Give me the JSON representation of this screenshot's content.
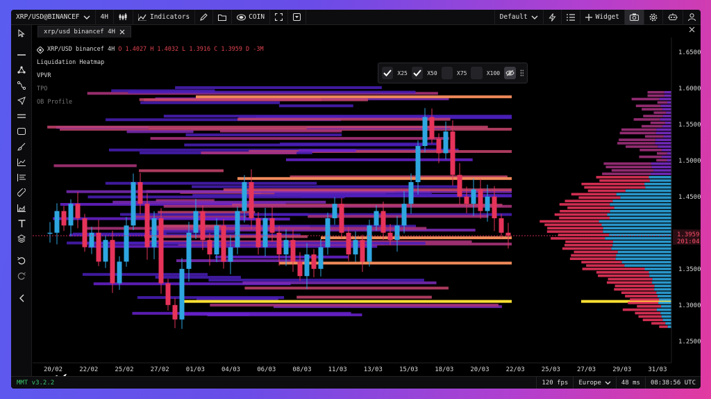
{
  "topbar": {
    "symbol": "XRP/USD@BINANCEF",
    "interval": "4H",
    "indicators_label": "Indicators",
    "coin_label": "COIN",
    "layout_label": "Default",
    "widget_label": "Widget"
  },
  "tab": {
    "label": "xrp/usd binancef 4H"
  },
  "legend": {
    "title": "XRP/USD binancef 4H",
    "o": "O 1.4027",
    "h": "H 1.4032",
    "l": "L 1.3916",
    "c": "C 1.3959",
    "d": "D -3M",
    "layers": [
      "Liquidation Heatmap",
      "VPVR",
      "TPO",
      "OB Profile"
    ]
  },
  "toggles": [
    "X25",
    "X50",
    "X75",
    "X100"
  ],
  "price_axis": [
    "1.6500",
    "1.6000",
    "1.5500",
    "1.5000",
    "1.4500",
    "1.4000",
    "1.3500",
    "1.3000",
    "1.2500"
  ],
  "price_tag": {
    "price": "1.3959",
    "countdown": "201:04"
  },
  "time_axis": [
    "20/02",
    "22/02",
    "25/02",
    "27/02",
    "01/03",
    "04/03",
    "06/03",
    "08/03",
    "11/03",
    "13/03",
    "15/03",
    "18/03",
    "20/03",
    "22/03",
    "25/03",
    "27/03",
    "29/03",
    "31/03"
  ],
  "status": {
    "version": "MMT v3.2.2",
    "fps": "120 fps",
    "region": "Europe",
    "latency": "48 ms",
    "clock": "08:38:56 UTC"
  },
  "colors": {
    "bull": "#2ea6e0",
    "bear": "#e6335a",
    "heat_low": "#4a1fb8",
    "heat_mid": "#b0357e",
    "heat_high": "#f08a5a",
    "heat_max": "#ffe033",
    "version": "#39c66f"
  },
  "chart_data": {
    "type": "candlestick",
    "title": "XRP/USD binancef 4H",
    "ylim": [
      1.22,
      1.67
    ],
    "last_price": 1.3959,
    "close_path": [
      1.4,
      1.43,
      1.41,
      1.44,
      1.42,
      1.38,
      1.4,
      1.36,
      1.39,
      1.33,
      1.36,
      1.41,
      1.47,
      1.44,
      1.38,
      1.42,
      1.33,
      1.3,
      1.28,
      1.35,
      1.4,
      1.43,
      1.39,
      1.37,
      1.41,
      1.36,
      1.38,
      1.43,
      1.47,
      1.42,
      1.38,
      1.42,
      1.4,
      1.37,
      1.39,
      1.36,
      1.34,
      1.37,
      1.35,
      1.38,
      1.42,
      1.44,
      1.4,
      1.37,
      1.39,
      1.36,
      1.41,
      1.43,
      1.4,
      1.39,
      1.41,
      1.44,
      1.47,
      1.52,
      1.56,
      1.53,
      1.51,
      1.54,
      1.48,
      1.45,
      1.44,
      1.46,
      1.43,
      1.45,
      1.42,
      1.4,
      1.3959
    ],
    "heat_levels": [
      {
        "price": 1.305,
        "intensity": "max"
      },
      {
        "price": 1.588,
        "intensity": "high"
      },
      {
        "price": 1.475,
        "intensity": "high"
      },
      {
        "price": 1.358,
        "intensity": "high"
      },
      {
        "price": 1.393,
        "intensity": "high"
      }
    ]
  }
}
